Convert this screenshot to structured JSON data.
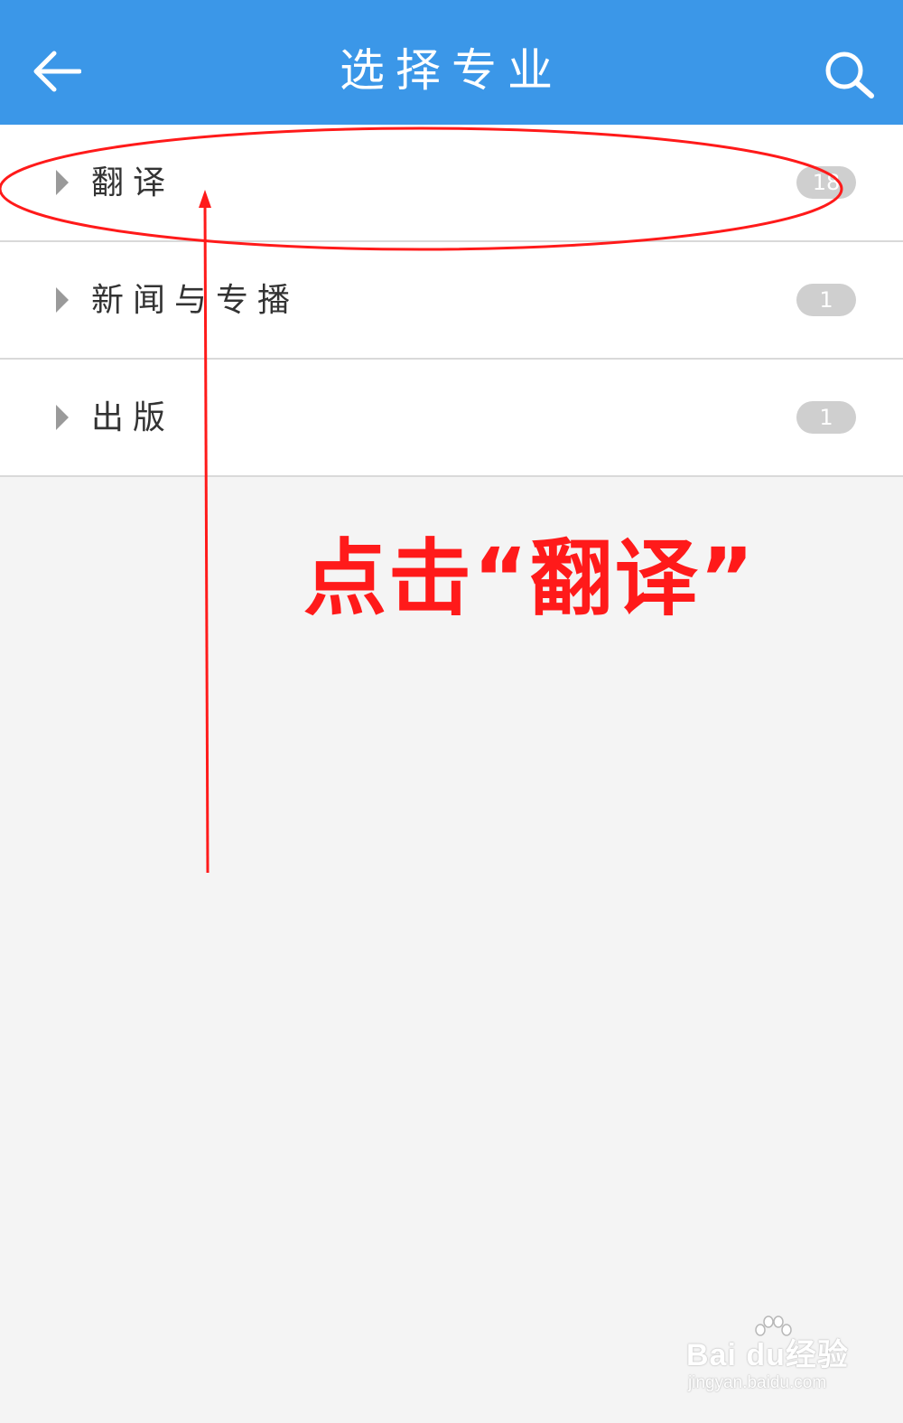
{
  "header": {
    "title": "选择专业",
    "back_icon": "arrow-left-icon",
    "search_icon": "search-icon"
  },
  "majors": [
    {
      "label": "翻译",
      "count": "18"
    },
    {
      "label": "新闻与专播",
      "count": "1"
    },
    {
      "label": "出版",
      "count": "1"
    }
  ],
  "annotation": {
    "text": "点击“翻译”",
    "color": "#ff1a1a"
  },
  "watermark": {
    "logo": "Bai du经验",
    "url": "jingyan.baidu.com"
  },
  "colors": {
    "header": "#3b97e8",
    "background": "#f4f4f4",
    "badge": "#cfcfcf"
  }
}
